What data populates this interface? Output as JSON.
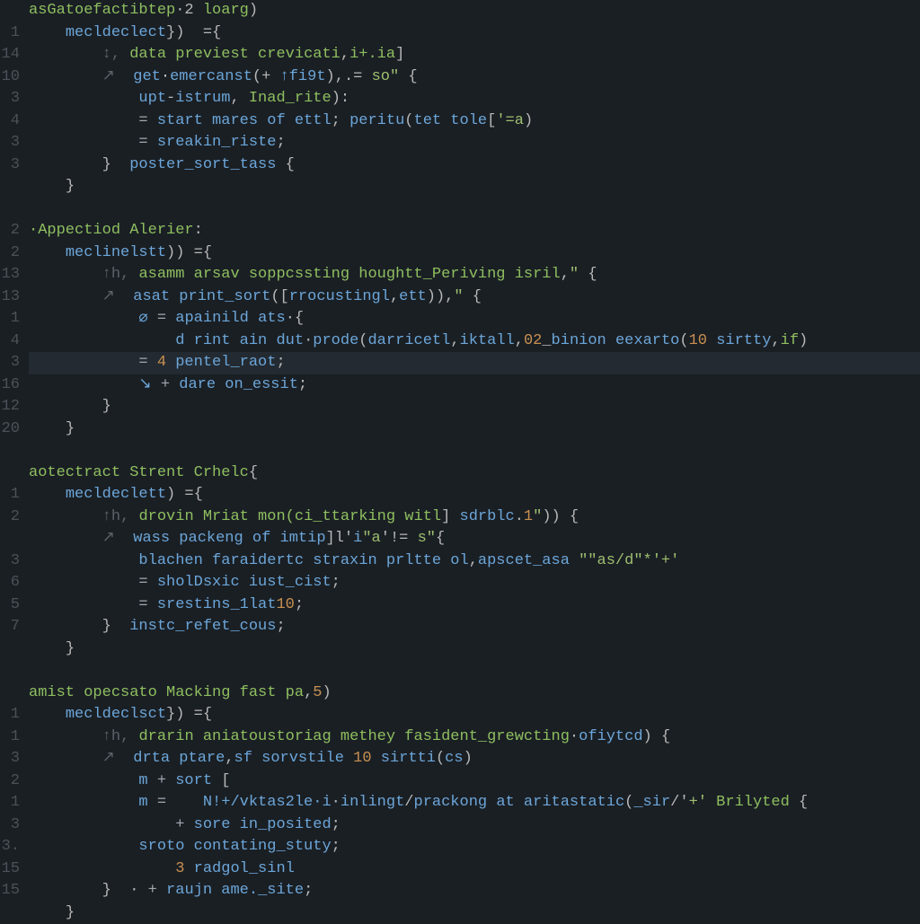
{
  "gutter_numbers": [
    "",
    "1",
    "14",
    "10",
    "3",
    "4",
    "3",
    "3",
    "",
    "",
    "2",
    "2",
    "13",
    "13",
    "1",
    "4",
    "3",
    "16",
    "12",
    "20",
    "",
    "",
    "1",
    "2",
    "",
    "3",
    "6",
    "5",
    "7",
    "",
    "",
    "",
    "1",
    "1",
    "3",
    "2",
    "1",
    "3",
    "3.",
    "15",
    "15",
    ""
  ],
  "lines": [
    {
      "indent": 0,
      "segs": [
        {
          "c": "section",
          "t": "asGatoefactibtep"
        },
        {
          "c": "pn",
          "t": "·2 "
        },
        {
          "c": "section",
          "t": "loarg"
        },
        {
          "c": "pn",
          "t": ")"
        }
      ]
    },
    {
      "indent": 1,
      "segs": [
        {
          "c": "fn",
          "t": "mecldeclect"
        },
        {
          "c": "pn",
          "t": "})  ="
        },
        {
          "c": "pn",
          "t": "{"
        }
      ]
    },
    {
      "indent": 2,
      "segs": [
        {
          "c": "cm",
          "t": "↕, "
        },
        {
          "c": "kw",
          "t": "data previest crevicati"
        },
        {
          "c": "pn",
          "t": ","
        },
        {
          "c": "kw",
          "t": "i+.ia"
        },
        {
          "c": "pn",
          "t": "]"
        }
      ]
    },
    {
      "indent": 2,
      "segs": [
        {
          "c": "cm",
          "t": "↗  "
        },
        {
          "c": "id",
          "t": "get"
        },
        {
          "c": "pl",
          "t": "·"
        },
        {
          "c": "fn",
          "t": "emercanst"
        },
        {
          "c": "pn",
          "t": "(+ "
        },
        {
          "c": "id",
          "t": "↑fi9t"
        },
        {
          "c": "pn",
          "t": "),.= "
        },
        {
          "c": "str",
          "t": "so\""
        },
        {
          "c": "pn",
          "t": " {"
        }
      ]
    },
    {
      "indent": 3,
      "segs": [
        {
          "c": "id",
          "t": "upt"
        },
        {
          "c": "pn",
          "t": "-"
        },
        {
          "c": "id",
          "t": "istrum"
        },
        {
          "c": "pn",
          "t": ", "
        },
        {
          "c": "ty",
          "t": "Inad_rite"
        },
        {
          "c": "pn",
          "t": "):"
        }
      ]
    },
    {
      "indent": 3,
      "segs": [
        {
          "c": "op",
          "t": "= "
        },
        {
          "c": "id",
          "t": "start mares of ettl"
        },
        {
          "c": "pn",
          "t": "; "
        },
        {
          "c": "fn",
          "t": "peritu"
        },
        {
          "c": "pn",
          "t": "("
        },
        {
          "c": "id",
          "t": "tet tole"
        },
        {
          "c": "pn",
          "t": "["
        },
        {
          "c": "str",
          "t": "'=a"
        },
        {
          "c": "pn",
          "t": ")"
        }
      ]
    },
    {
      "indent": 3,
      "segs": [
        {
          "c": "op",
          "t": "= "
        },
        {
          "c": "id",
          "t": "sreakin_riste"
        },
        {
          "c": "pn",
          "t": ";"
        }
      ]
    },
    {
      "indent": 2,
      "segs": [
        {
          "c": "pn",
          "t": "}  "
        },
        {
          "c": "fn",
          "t": "poster_sort_tass"
        },
        {
          "c": "pn",
          "t": " {"
        }
      ]
    },
    {
      "indent": 1,
      "segs": [
        {
          "c": "pn",
          "t": "}"
        }
      ]
    },
    {
      "indent": 0,
      "segs": [
        {
          "c": "pl",
          "t": ""
        }
      ]
    },
    {
      "indent": 0,
      "segs": [
        {
          "c": "section",
          "t": "·Appectiod Alerier"
        },
        {
          "c": "pn",
          "t": ":"
        }
      ]
    },
    {
      "indent": 1,
      "segs": [
        {
          "c": "fn",
          "t": "meclinelstt"
        },
        {
          "c": "pn",
          "t": ")) ="
        },
        {
          "c": "pn",
          "t": "{"
        }
      ]
    },
    {
      "indent": 2,
      "segs": [
        {
          "c": "cm",
          "t": "↑h, "
        },
        {
          "c": "kw",
          "t": "asamm arsav soppcssting houghtt_Periving isril"
        },
        {
          "c": "pn",
          "t": ","
        },
        {
          "c": "str",
          "t": "\""
        },
        {
          "c": "pn",
          "t": " {"
        }
      ]
    },
    {
      "indent": 2,
      "segs": [
        {
          "c": "cm",
          "t": "↗  "
        },
        {
          "c": "id",
          "t": "asat "
        },
        {
          "c": "fn",
          "t": "print_sort"
        },
        {
          "c": "pn",
          "t": "(["
        },
        {
          "c": "id",
          "t": "rrocustingl"
        },
        {
          "c": "pn",
          "t": ","
        },
        {
          "c": "id",
          "t": "ett"
        },
        {
          "c": "pn",
          "t": ")),"
        },
        {
          "c": "str",
          "t": "\""
        },
        {
          "c": "pn",
          "t": " {"
        }
      ]
    },
    {
      "indent": 3,
      "segs": [
        {
          "c": "var",
          "t": "⌀ "
        },
        {
          "c": "op",
          "t": "= "
        },
        {
          "c": "id",
          "t": "apainild ats"
        },
        {
          "c": "pn",
          "t": "·{"
        }
      ]
    },
    {
      "indent": 4,
      "segs": [
        {
          "c": "id",
          "t": "d rint ain dut"
        },
        {
          "c": "pn",
          "t": "·"
        },
        {
          "c": "fn",
          "t": "prode"
        },
        {
          "c": "pn",
          "t": "("
        },
        {
          "c": "id",
          "t": "darricetl"
        },
        {
          "c": "pn",
          "t": ","
        },
        {
          "c": "id",
          "t": "iktall"
        },
        {
          "c": "pn",
          "t": ","
        },
        {
          "c": "num",
          "t": "02"
        },
        {
          "c": "pn",
          "t": "_"
        },
        {
          "c": "id",
          "t": "binion "
        },
        {
          "c": "fn",
          "t": "eexarto"
        },
        {
          "c": "pn",
          "t": "("
        },
        {
          "c": "num",
          "t": "10"
        },
        {
          "c": "pl",
          "t": " "
        },
        {
          "c": "id",
          "t": "sirtty"
        },
        {
          "c": "pn",
          "t": ","
        },
        {
          "c": "kw",
          "t": "if"
        },
        {
          "c": "pn",
          "t": ")"
        }
      ]
    },
    {
      "indent": 3,
      "hl": true,
      "segs": [
        {
          "c": "op",
          "t": "= "
        },
        {
          "c": "num",
          "t": "4"
        },
        {
          "c": "pl",
          "t": " "
        },
        {
          "c": "id",
          "t": "pentel_raot"
        },
        {
          "c": "pn",
          "t": ";"
        }
      ]
    },
    {
      "indent": 3,
      "segs": [
        {
          "c": "var",
          "t": "↘ "
        },
        {
          "c": "op",
          "t": "+ "
        },
        {
          "c": "id",
          "t": "dare on_essit"
        },
        {
          "c": "pn",
          "t": ";"
        }
      ]
    },
    {
      "indent": 2,
      "segs": [
        {
          "c": "pn",
          "t": "}"
        }
      ]
    },
    {
      "indent": 1,
      "segs": [
        {
          "c": "pn",
          "t": "}"
        }
      ]
    },
    {
      "indent": 0,
      "segs": [
        {
          "c": "pl",
          "t": ""
        }
      ]
    },
    {
      "indent": 0,
      "segs": [
        {
          "c": "section",
          "t": "aotectract Strent Crhelc"
        },
        {
          "c": "pn",
          "t": "{"
        }
      ]
    },
    {
      "indent": 1,
      "segs": [
        {
          "c": "fn",
          "t": "mecldeclett"
        },
        {
          "c": "pn",
          "t": ") ="
        },
        {
          "c": "pn",
          "t": "{"
        }
      ]
    },
    {
      "indent": 2,
      "segs": [
        {
          "c": "cm",
          "t": "↑h, "
        },
        {
          "c": "kw",
          "t": "drovin Mriat mon(ci_ttarking witl"
        },
        {
          "c": "pn",
          "t": "] "
        },
        {
          "c": "id",
          "t": "sdrblc"
        },
        {
          "c": "pn",
          "t": "."
        },
        {
          "c": "num",
          "t": "1"
        },
        {
          "c": "str",
          "t": "\""
        },
        {
          "c": "pn",
          "t": ")) {"
        }
      ]
    },
    {
      "indent": 2,
      "segs": [
        {
          "c": "cm",
          "t": "↗  "
        },
        {
          "c": "id",
          "t": "wass packeng of imtip"
        },
        {
          "c": "pn",
          "t": "]l'"
        },
        {
          "c": "id",
          "t": "i"
        },
        {
          "c": "str",
          "t": "\"a"
        },
        {
          "c": "pn",
          "t": "'!= "
        },
        {
          "c": "str",
          "t": "s\""
        },
        {
          "c": "pn",
          "t": "{"
        }
      ]
    },
    {
      "indent": 3,
      "segs": [
        {
          "c": "id",
          "t": "blachen faraidertc straxin prltte ol"
        },
        {
          "c": "pn",
          "t": ","
        },
        {
          "c": "id",
          "t": "apscet_asa "
        },
        {
          "c": "str",
          "t": "\"\"as/d\"*'+'"
        }
      ]
    },
    {
      "indent": 3,
      "segs": [
        {
          "c": "op",
          "t": "= "
        },
        {
          "c": "id",
          "t": "sholDsxic iust_cist"
        },
        {
          "c": "pn",
          "t": ";"
        }
      ]
    },
    {
      "indent": 3,
      "segs": [
        {
          "c": "op",
          "t": "= "
        },
        {
          "c": "id",
          "t": "srestins_1lat"
        },
        {
          "c": "num",
          "t": "10"
        },
        {
          "c": "pn",
          "t": ";"
        }
      ]
    },
    {
      "indent": 2,
      "segs": [
        {
          "c": "pn",
          "t": "}  "
        },
        {
          "c": "id",
          "t": "instc_refet_cous"
        },
        {
          "c": "pn",
          "t": ";"
        }
      ]
    },
    {
      "indent": 1,
      "segs": [
        {
          "c": "pn",
          "t": "}"
        }
      ]
    },
    {
      "indent": 0,
      "segs": [
        {
          "c": "pl",
          "t": ""
        }
      ]
    },
    {
      "indent": 0,
      "segs": [
        {
          "c": "section",
          "t": "amist opecsato Macking fast pa"
        },
        {
          "c": "pn",
          "t": ","
        },
        {
          "c": "num",
          "t": "5"
        },
        {
          "c": "pn",
          "t": ")"
        }
      ]
    },
    {
      "indent": 1,
      "segs": [
        {
          "c": "fn",
          "t": "mecldeclsct"
        },
        {
          "c": "pn",
          "t": "}) ="
        },
        {
          "c": "pn",
          "t": "{"
        }
      ]
    },
    {
      "indent": 2,
      "segs": [
        {
          "c": "cm",
          "t": "↑h, "
        },
        {
          "c": "kw",
          "t": "drarin aniatoustoriag methey fasident_grewcting"
        },
        {
          "c": "pn",
          "t": "·"
        },
        {
          "c": "id",
          "t": "ofiytcd"
        },
        {
          "c": "pn",
          "t": ") {"
        }
      ]
    },
    {
      "indent": 2,
      "segs": [
        {
          "c": "cm",
          "t": "↗  "
        },
        {
          "c": "id",
          "t": "drta ptare"
        },
        {
          "c": "pn",
          "t": ","
        },
        {
          "c": "id",
          "t": "sf sorvstile "
        },
        {
          "c": "num",
          "t": "10"
        },
        {
          "c": "pl",
          "t": " "
        },
        {
          "c": "fn",
          "t": "sirtti"
        },
        {
          "c": "pn",
          "t": "("
        },
        {
          "c": "id",
          "t": "cs"
        },
        {
          "c": "pn",
          "t": ")"
        }
      ]
    },
    {
      "indent": 3,
      "segs": [
        {
          "c": "var",
          "t": "m "
        },
        {
          "c": "op",
          "t": "+ "
        },
        {
          "c": "id",
          "t": "sort "
        },
        {
          "c": "pn",
          "t": "["
        }
      ]
    },
    {
      "indent": 3,
      "segs": [
        {
          "c": "var",
          "t": "m "
        },
        {
          "c": "op",
          "t": "=  "
        },
        {
          "c": "id",
          "t": "  N!+/vktas2le·i"
        },
        {
          "c": "pn",
          "t": "·"
        },
        {
          "c": "id",
          "t": "inlingt"
        },
        {
          "c": "pn",
          "t": "/"
        },
        {
          "c": "id",
          "t": "prackong at "
        },
        {
          "c": "fn",
          "t": "aritastatic"
        },
        {
          "c": "pn",
          "t": "("
        },
        {
          "c": "id",
          "t": "_sir"
        },
        {
          "c": "pn",
          "t": "/'"
        },
        {
          "c": "str",
          "t": "+'"
        },
        {
          "c": "pl",
          "t": " "
        },
        {
          "c": "ty",
          "t": "Brilyted"
        },
        {
          "c": "pn",
          "t": " {"
        }
      ]
    },
    {
      "indent": 4,
      "segs": [
        {
          "c": "op",
          "t": "+ "
        },
        {
          "c": "id",
          "t": "sore in_posited"
        },
        {
          "c": "pn",
          "t": ";"
        }
      ]
    },
    {
      "indent": 3,
      "segs": [
        {
          "c": "id",
          "t": "sroto contating_stuty"
        },
        {
          "c": "pn",
          "t": ";"
        }
      ]
    },
    {
      "indent": 4,
      "segs": [
        {
          "c": "num",
          "t": "3"
        },
        {
          "c": "pl",
          "t": " "
        },
        {
          "c": "id",
          "t": "radgol_sinl"
        }
      ]
    },
    {
      "indent": 2,
      "segs": [
        {
          "c": "pn",
          "t": "}  · "
        },
        {
          "c": "op",
          "t": "+ "
        },
        {
          "c": "id",
          "t": "raujn ame._site"
        },
        {
          "c": "pn",
          "t": ";"
        }
      ]
    },
    {
      "indent": 1,
      "segs": [
        {
          "c": "pn",
          "t": "}"
        }
      ]
    }
  ]
}
